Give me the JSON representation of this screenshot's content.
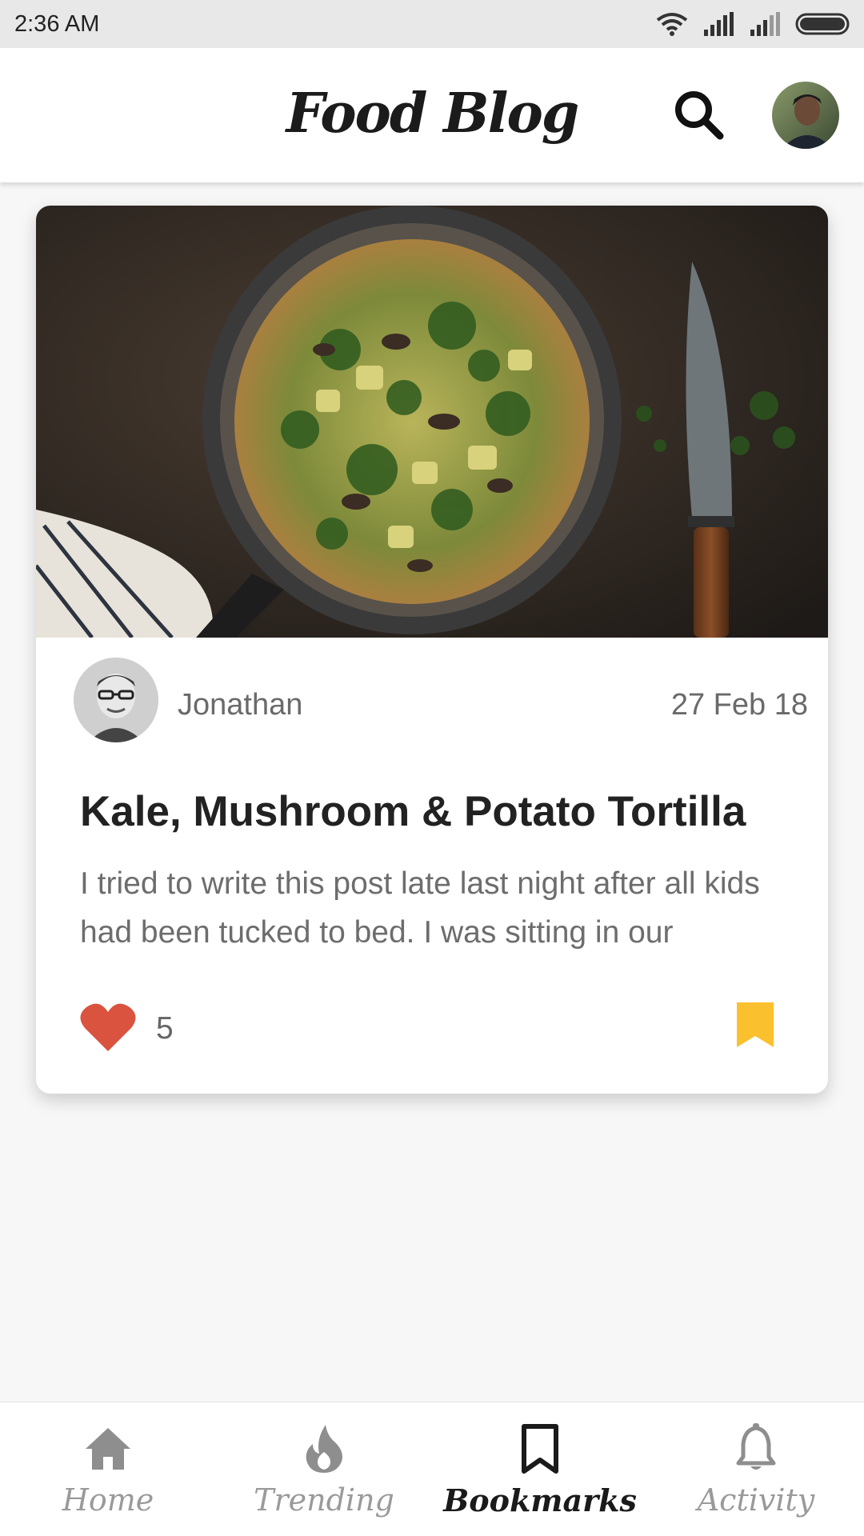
{
  "status_bar": {
    "time": "2:36 AM"
  },
  "app_bar": {
    "title": "Food Blog"
  },
  "post": {
    "author": "Jonathan",
    "date": "27 Feb 18",
    "title": "Kale, Mushroom & Potato Tortilla",
    "excerpt": "I tried to write this post late last night after all kids had been tucked to bed. I was sitting in our",
    "likes": "5",
    "bookmarked": true
  },
  "bottom_nav": {
    "items": [
      {
        "label": "Home",
        "icon": "home-icon"
      },
      {
        "label": "Trending",
        "icon": "flame-icon"
      },
      {
        "label": "Bookmarks",
        "icon": "bookmark-icon"
      },
      {
        "label": "Activity",
        "icon": "bell-icon"
      }
    ],
    "active_index": 2
  },
  "colors": {
    "like": "#d9533f",
    "bookmark": "#fbc02d",
    "active_nav": "#1a1a1a",
    "inactive_nav": "#9a9a9a"
  }
}
